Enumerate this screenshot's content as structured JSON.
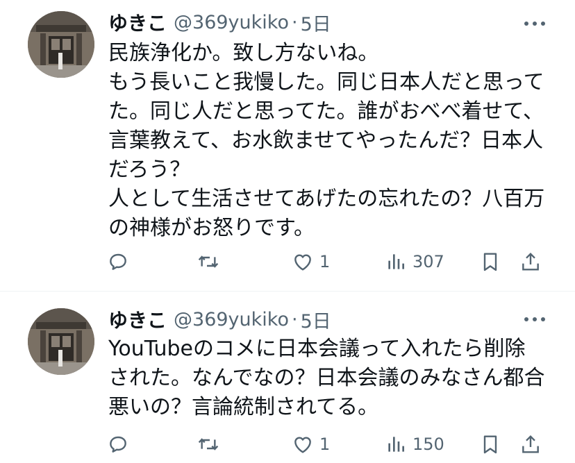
{
  "tweets": [
    {
      "name": "ゆきこ",
      "handle": "@369yukiko",
      "separator": "·",
      "time": "5日",
      "lines": [
        "民族浄化か。致し方ないね。",
        "もう長いこと我慢した。同じ日本人だと思って",
        "た。同じ人だと思ってた。誰がおべべ着せて、",
        "言葉教えて、お水飲ませてやったんだ？日本人",
        "だろう？",
        "人として生活させてあげたの忘れたの？八百万",
        "の神様がお怒りです。"
      ],
      "likes": "1",
      "views": "307"
    },
    {
      "name": "ゆきこ",
      "handle": "@369yukiko",
      "separator": "·",
      "time": "5日",
      "lines": [
        "YouTubeのコメに日本会議って入れたら削除",
        "された。なんでなの？日本会議のみなさん都合",
        "悪いの？言論統制されてる。"
      ],
      "likes": "1",
      "views": "150"
    }
  ],
  "icons": {
    "reply": "reply-icon",
    "retweet": "retweet-icon",
    "like": "heart-icon",
    "views": "views-icon",
    "bookmark": "bookmark-icon",
    "share": "share-icon",
    "more": "more-icon"
  },
  "colors": {
    "text": "#0f1419",
    "secondary": "#536471",
    "divider": "#eff3f4"
  }
}
